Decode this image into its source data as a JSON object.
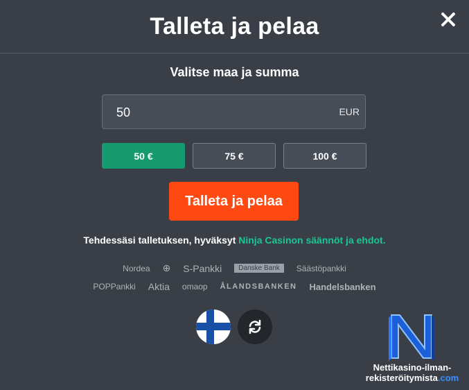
{
  "modal": {
    "title": "Talleta ja pelaa",
    "subtitle": "Valitse maa ja summa"
  },
  "amount": {
    "value": "50",
    "currency": "EUR"
  },
  "presets": [
    {
      "label": "50 €",
      "active": true
    },
    {
      "label": "75 €",
      "active": false
    },
    {
      "label": "100 €",
      "active": false
    }
  ],
  "cta_label": "Talleta ja pelaa",
  "terms": {
    "text": "Tehdessäsi talletuksen, hyväksyt ",
    "link": "Ninja Casinon säännöt ja ehdot."
  },
  "banks_row1": [
    "Nordea",
    "",
    "S-Pankki",
    "Danske Bank",
    "Säästöpankki"
  ],
  "banks_row2": [
    "POPPankki",
    "Aktia",
    "omaop",
    "ÅLANDSBANKEN",
    "Handelsbanken"
  ],
  "watermark": {
    "line1": "Nettikasino-ilman-",
    "line2": "rekisteröitymista",
    "line2_domain": ".com"
  },
  "colors": {
    "accent_green": "#169a6e",
    "cta_orange": "#fe4a12",
    "link_green": "#19c796",
    "background": "#3a3f47"
  }
}
